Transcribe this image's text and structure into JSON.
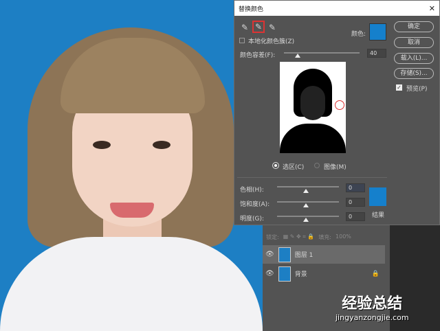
{
  "dialog": {
    "title": "替换颜色",
    "close": "✕",
    "color_label": "颜色:",
    "localized_label": "本地化颜色簇(Z)",
    "tolerance_label": "颜色容差(F):",
    "tolerance_value": "40",
    "tolerance": 40,
    "buttons": {
      "ok": "确定",
      "cancel": "取消",
      "load": "载入(L)...",
      "save": "存储(S)..."
    },
    "preview_label": "预览(P)",
    "radio_selection": "选区(C)",
    "radio_image": "图像(M)",
    "hue_label": "色相(H):",
    "hue_value": "0",
    "sat_label": "饱和度(A):",
    "sat_value": "0",
    "light_label": "明度(G):",
    "light_value": "0",
    "result_label": "结果",
    "color": "#1580cc"
  },
  "layers": {
    "lock_label": "锁定:",
    "fill_label": "填充:",
    "fill_value": "100%",
    "items": [
      {
        "name": "图层 1"
      },
      {
        "name": "背景"
      }
    ]
  },
  "watermark": {
    "title": "经验总结",
    "url": "jingyanzongjie.com"
  }
}
